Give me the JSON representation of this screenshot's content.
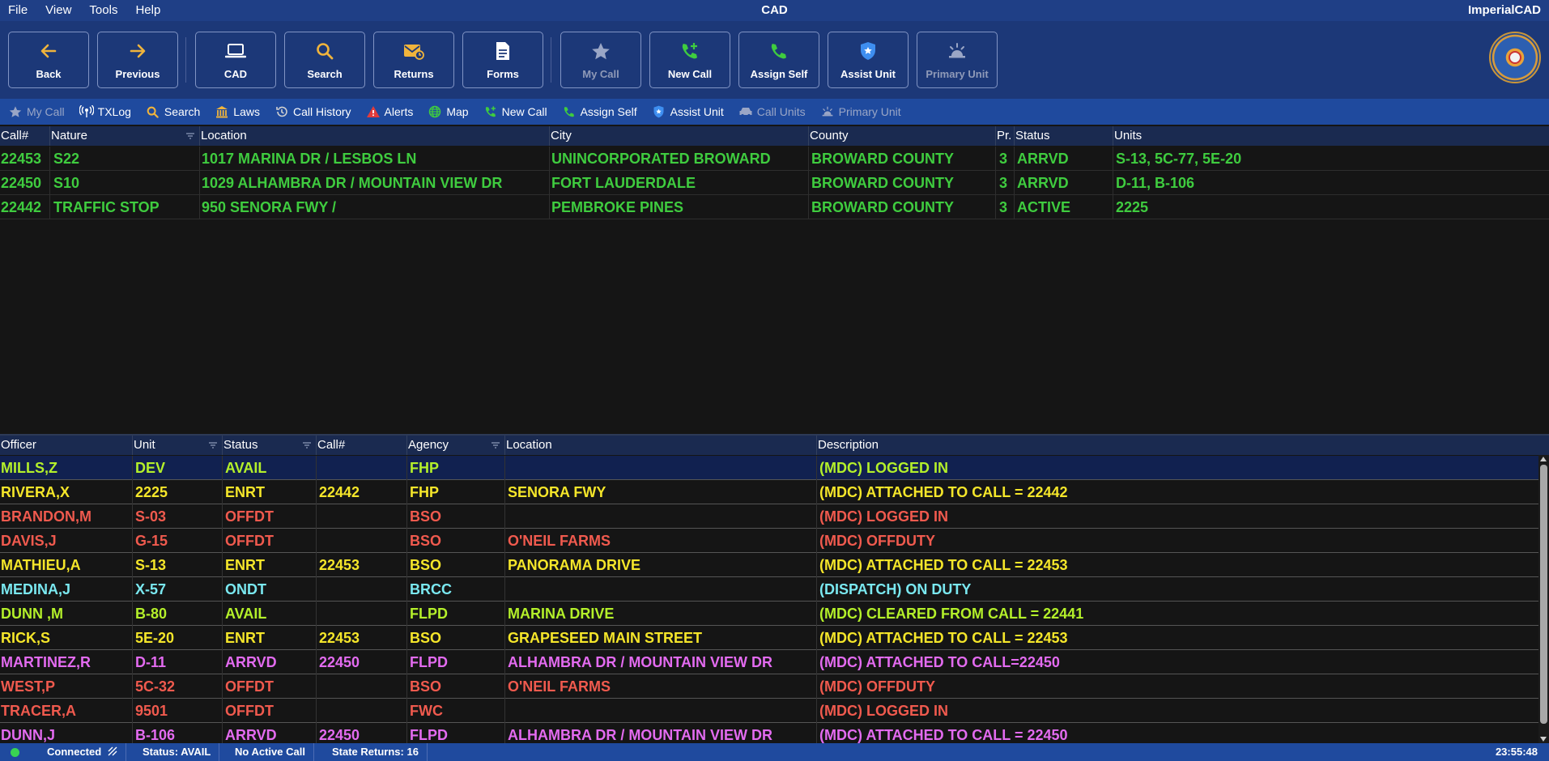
{
  "titlebar": {
    "menu": [
      "File",
      "View",
      "Tools",
      "Help"
    ],
    "title": "CAD",
    "app_name": "ImperialCAD"
  },
  "toolbar": {
    "buttons": [
      {
        "label": "Back",
        "icon": "arrow-left-icon"
      },
      {
        "label": "Previous",
        "icon": "arrow-right-icon"
      },
      {
        "label": "CAD",
        "icon": "laptop-icon"
      },
      {
        "label": "Search",
        "icon": "search-icon"
      },
      {
        "label": "Returns",
        "icon": "mail-icon"
      },
      {
        "label": "Forms",
        "icon": "document-icon"
      },
      {
        "label": "My Call",
        "icon": "star-icon"
      },
      {
        "label": "New Call",
        "icon": "phone-plus-icon"
      },
      {
        "label": "Assign Self",
        "icon": "phone-icon"
      },
      {
        "label": "Assist Unit",
        "icon": "shield-icon"
      },
      {
        "label": "Primary Unit",
        "icon": "siren-icon"
      }
    ],
    "seal_label": "FLORIDA HIGHWAY PATROL"
  },
  "quickbar": {
    "items": [
      {
        "label": "My Call",
        "icon": "star-icon"
      },
      {
        "label": "TXLog",
        "icon": "broadcast-icon"
      },
      {
        "label": "Search",
        "icon": "search-icon"
      },
      {
        "label": "Laws",
        "icon": "courthouse-icon"
      },
      {
        "label": "Call History",
        "icon": "history-icon"
      },
      {
        "label": "Alerts",
        "icon": "alert-icon"
      },
      {
        "label": "Map",
        "icon": "globe-icon"
      },
      {
        "label": "New Call",
        "icon": "phone-plus-icon"
      },
      {
        "label": "Assign Self",
        "icon": "phone-icon"
      },
      {
        "label": "Assist Unit",
        "icon": "shield-icon"
      },
      {
        "label": "Call Units",
        "icon": "car-icon"
      },
      {
        "label": "Primary Unit",
        "icon": "siren-icon"
      }
    ]
  },
  "calls": {
    "columns": [
      "Call#",
      "Nature",
      "Location",
      "City",
      "County",
      "Pr.",
      "Status",
      "Units"
    ],
    "rows": [
      [
        "22453",
        "S22",
        "1017 MARINA DR / LESBOS LN",
        "UNINCORPORATED BROWARD",
        "BROWARD COUNTY",
        "3",
        "ARRVD",
        "S-13, 5C-77, 5E-20"
      ],
      [
        "22450",
        "S10",
        "1029 ALHAMBRA DR / MOUNTAIN VIEW DR",
        "FORT LAUDERDALE",
        "BROWARD COUNTY",
        "3",
        "ARRVD",
        "D-11, B-106"
      ],
      [
        "22442",
        "TRAFFIC STOP",
        "950 SENORA FWY /",
        "PEMBROKE PINES",
        "BROWARD COUNTY",
        "3",
        "ACTIVE",
        "2225"
      ]
    ],
    "row_color": "#3fcc3f"
  },
  "units": {
    "columns": [
      "Officer",
      "Unit",
      "Status",
      "Call#",
      "Agency",
      "Location",
      "Description"
    ],
    "rows": [
      {
        "cells": [
          "MILLS,Z",
          "DEV",
          "AVAIL",
          "",
          "FHP",
          "",
          "(MDC) LOGGED IN"
        ],
        "color": "#b4f02a",
        "highlight": true
      },
      {
        "cells": [
          "RIVERA,X",
          "2225",
          "ENRT",
          "22442",
          "FHP",
          "SENORA FWY",
          "(MDC) ATTACHED TO CALL = 22442"
        ],
        "color": "#f5e62a",
        "highlight": false
      },
      {
        "cells": [
          "BRANDON,M",
          "S-03",
          "OFFDT",
          "",
          "BSO",
          "",
          "(MDC) LOGGED IN"
        ],
        "color": "#f05a4e",
        "highlight": false
      },
      {
        "cells": [
          "DAVIS,J",
          "G-15",
          "OFFDT",
          "",
          "BSO",
          "O'NEIL FARMS",
          "(MDC) OFFDUTY"
        ],
        "color": "#f05a4e",
        "highlight": false
      },
      {
        "cells": [
          "MATHIEU,A",
          "S-13",
          "ENRT",
          "22453",
          "BSO",
          "PANORAMA DRIVE",
          "(MDC) ATTACHED TO CALL = 22453"
        ],
        "color": "#f5e62a",
        "highlight": false
      },
      {
        "cells": [
          "MEDINA,J",
          "X-57",
          "ONDT",
          "",
          "BRCC",
          "",
          "(DISPATCH) ON DUTY"
        ],
        "color": "#7ae8f0",
        "highlight": false
      },
      {
        "cells": [
          "DUNN ,M",
          "B-80",
          "AVAIL",
          "",
          "FLPD",
          "MARINA DRIVE",
          "(MDC) CLEARED FROM CALL = 22441"
        ],
        "color": "#b4f02a",
        "highlight": false
      },
      {
        "cells": [
          "RICK,S",
          "5E-20",
          "ENRT",
          "22453",
          "BSO",
          "GRAPESEED MAIN STREET",
          "(MDC) ATTACHED TO CALL = 22453"
        ],
        "color": "#f5e62a",
        "highlight": false
      },
      {
        "cells": [
          "MARTINEZ,R",
          "D-11",
          "ARRVD",
          "22450",
          "FLPD",
          "ALHAMBRA DR / MOUNTAIN VIEW DR",
          "(MDC) ATTACHED TO CALL=22450"
        ],
        "color": "#e36bf0",
        "highlight": false
      },
      {
        "cells": [
          "WEST,P",
          "5C-32",
          "OFFDT",
          "",
          "BSO",
          "O'NEIL FARMS",
          "(MDC) OFFDUTY"
        ],
        "color": "#f05a4e",
        "highlight": false
      },
      {
        "cells": [
          "TRACER,A",
          "9501",
          "OFFDT",
          "",
          "FWC",
          "",
          "(MDC) LOGGED IN"
        ],
        "color": "#f05a4e",
        "highlight": false
      },
      {
        "cells": [
          "DUNN,J",
          "B-106",
          "ARRVD",
          "22450",
          "FLPD",
          "ALHAMBRA DR / MOUNTAIN VIEW DR",
          "(MDC) ATTACHED TO CALL = 22450"
        ],
        "color": "#e36bf0",
        "highlight": false
      }
    ]
  },
  "statusbar": {
    "connection": "Connected",
    "status": "Status: AVAIL",
    "active_call": "No Active Call",
    "state_returns": "State Returns: 16",
    "clock": "23:55:48",
    "connected_color": "#39d353"
  }
}
